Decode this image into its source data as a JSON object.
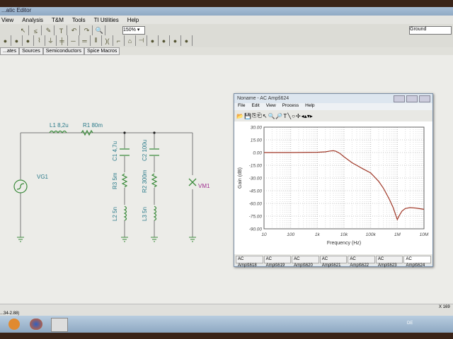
{
  "app": {
    "title": "...atic Editor",
    "ground_selector": "Ground"
  },
  "menu": [
    "View",
    "Analysis",
    "T&M",
    "Tools",
    "TI Utilities",
    "Help"
  ],
  "zoom_level": "150%",
  "component_tabs": [
    "...ates",
    "Sources",
    "Semiconductors",
    "Spice Macros"
  ],
  "schematic": {
    "components": [
      {
        "id": "L1",
        "value": "8,2u",
        "label": "L1 8,2u"
      },
      {
        "id": "R1",
        "value": "80m",
        "label": "R1 80m"
      },
      {
        "id": "C1",
        "value": "4,7u",
        "label": "C1 4,7u"
      },
      {
        "id": "C2",
        "value": "100u",
        "label": "C2 100u"
      },
      {
        "id": "R3",
        "value": "5m",
        "label": "R3 5m"
      },
      {
        "id": "R2",
        "value": "300m",
        "label": "R2 300m"
      },
      {
        "id": "L2",
        "value": "5n",
        "label": "L2 5n"
      },
      {
        "id": "L3",
        "value": "5n",
        "label": "L3 5n"
      },
      {
        "id": "VG1",
        "label": "VG1"
      },
      {
        "id": "VM1",
        "label": "VM1"
      }
    ]
  },
  "status": {
    "coords": "...34-2.88)",
    "right": "X 169"
  },
  "taskbar": {
    "lang": "DE"
  },
  "chart_window": {
    "title": "Noname - AC Ampš624",
    "menu": [
      "File",
      "Edit",
      "View",
      "Process",
      "Help"
    ],
    "tabs": [
      "AC Amplš618",
      "AC Amplš619",
      "AC Amplš620",
      "AC Amplš621",
      "AC Amplš622",
      "AC Amplš623",
      "AC Amplš624"
    ],
    "active_tab": 6
  },
  "chart_data": {
    "type": "line",
    "title": "",
    "xlabel": "Frequency (Hz)",
    "ylabel": "Gain (dB)",
    "xscale": "log",
    "xlim": [
      10,
      10000000
    ],
    "ylim": [
      -90,
      30
    ],
    "xticks": [
      "10",
      "100",
      "1k",
      "10k",
      "100k",
      "1M",
      "10M"
    ],
    "yticks": [
      "30.00",
      "15.00",
      "0.00",
      "-15.00",
      "-30.00",
      "-45.00",
      "-60.00",
      "-75.00",
      "-90.00"
    ],
    "grid": true,
    "color": "#a03828",
    "series": [
      {
        "name": "Gain",
        "x": [
          10,
          100,
          1000,
          2000,
          3000,
          4000,
          5000,
          7000,
          10000,
          20000,
          50000,
          100000,
          200000,
          300000,
          500000,
          700000,
          900000,
          1000000,
          1200000,
          1500000,
          2000000,
          3000000,
          5000000,
          10000000
        ],
        "y": [
          0,
          0,
          0.3,
          0.8,
          1.8,
          2.2,
          1.5,
          -1,
          -5,
          -12,
          -19,
          -24,
          -34,
          -42,
          -55,
          -65,
          -75,
          -79,
          -74,
          -69,
          -66,
          -65,
          -65.5,
          -67
        ]
      }
    ]
  }
}
